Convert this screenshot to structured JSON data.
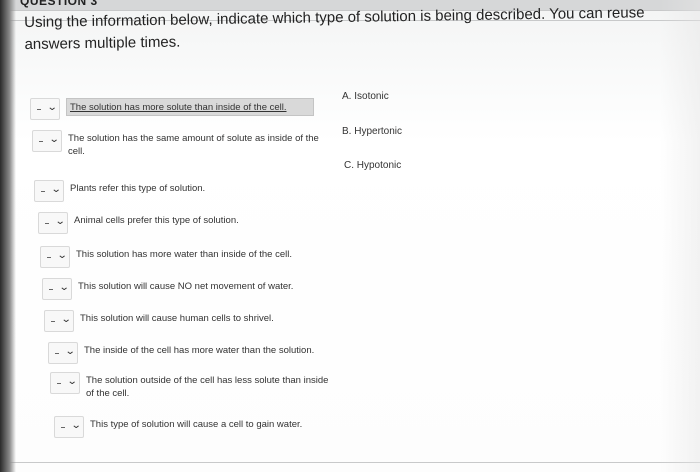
{
  "header": {
    "question_tab": "QUESTION 3"
  },
  "prompt": "Using the information below, indicate which type of solution is being described. You can reuse answers multiple times.",
  "statements": [
    {
      "text": "The solution has more solute than inside of the cell."
    },
    {
      "text": "The solution has the same amount of solute as inside of the cell."
    },
    {
      "text": "Plants refer this type of solution."
    },
    {
      "text": "Animal cells prefer this type of solution."
    },
    {
      "text": "This solution has more water than inside of the cell."
    },
    {
      "text": "This solution will cause NO net movement of water."
    },
    {
      "text": "This solution will cause human cells to shrivel."
    },
    {
      "text": "The inside of the cell has more water than the solution."
    },
    {
      "text": "The solution outside of the cell has less solute than inside of the cell."
    },
    {
      "text": "This type of solution will cause a cell to gain water."
    }
  ],
  "answers": [
    {
      "label": "A. Isotonic"
    },
    {
      "label": "B. Hypertonic"
    },
    {
      "label": "C. Hypotonic"
    }
  ],
  "dropdown": {
    "selected": "-",
    "icon": "chevron-down-icon"
  }
}
